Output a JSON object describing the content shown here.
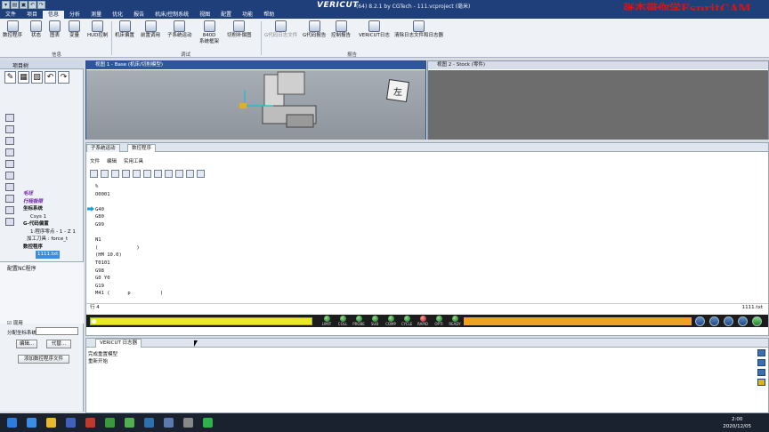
{
  "title": {
    "logo": "VERICUT",
    "text": "(64) 8.2.1 by CGTech - 111.vcproject (毫米)",
    "watermark": "张杰带你学EspritCAM"
  },
  "menu": [
    "文件",
    "项目",
    "信息",
    "分析",
    "测量",
    "优化",
    "报告",
    "机床/控制系统",
    "视图",
    "配置",
    "功能",
    "帮助"
  ],
  "menu_active_index": 2,
  "ribbon": {
    "buttons": [
      {
        "label": "数控程序"
      },
      {
        "label": "状态"
      },
      {
        "label": "图表"
      },
      {
        "label": "变量"
      },
      {
        "label": "HUD控制"
      },
      {
        "label": "机床偏置"
      },
      {
        "label": "前置调用"
      },
      {
        "label": "子系统运动"
      },
      {
        "label": "840D\n系统框架"
      },
      {
        "label": "切削补偿图"
      },
      {
        "label": "G代码日志文件",
        "disabled": true
      },
      {
        "label": "G代码报告"
      },
      {
        "label": "控制报告"
      },
      {
        "label": "VERICUT日志"
      },
      {
        "label": "清除日志文件和日志器"
      }
    ],
    "groups": [
      "信息",
      "调试",
      "报告"
    ]
  },
  "left_panel": {
    "header": "项目树",
    "tree": [
      {
        "text": "毛坯",
        "style": "hl"
      },
      {
        "text": "行程极限",
        "style": "hl"
      },
      {
        "text": "坐标系统",
        "style": "bold"
      },
      {
        "text": "Csys 1",
        "style": "normal"
      },
      {
        "text": "G-代码偏置",
        "style": "bold"
      },
      {
        "text": "1:程序零点 - 1 - Z 1",
        "style": "normal"
      },
      {
        "text": "加工刀具 : force_t",
        "style": "normal"
      },
      {
        "text": "数控程序",
        "style": "bold"
      },
      {
        "text": "1111.txt",
        "style": "sel"
      }
    ],
    "sub_header": "配置NC程序",
    "checkbox_label": "现用",
    "coord_label": "分配坐标系统",
    "edit_button": "编辑...",
    "replace_button": "代替...",
    "add_button": "添加数控程序文件"
  },
  "view1": {
    "title": "视图 1 - Base (机床/切削模型)",
    "cube_label": "左"
  },
  "view2": {
    "title": "视图 2 - Stock (零件)"
  },
  "editor": {
    "tabs": [
      "子系统运动",
      "数控程序"
    ],
    "active_tab": 1,
    "menu": [
      "文件",
      "编辑",
      "实用工具"
    ],
    "lines": [
      "%",
      "O0001",
      "",
      "G40",
      "G80",
      "G99",
      "",
      "N1",
      "(             )",
      "(HM 10.0)",
      "T0101",
      "G98",
      "G0 Y0",
      "G19",
      "M41 (      p          )"
    ],
    "status_left": "行 4",
    "status_right": "1111.txt",
    "progress": 0.0,
    "leds": [
      {
        "label": "LIMIT",
        "color": "green"
      },
      {
        "label": "COLL",
        "color": "green"
      },
      {
        "label": "PROBE",
        "color": "green"
      },
      {
        "label": "SUB",
        "color": "green"
      },
      {
        "label": "COMP",
        "color": "green"
      },
      {
        "label": "CYCLE",
        "color": "green"
      },
      {
        "label": "RAPID",
        "color": "red"
      },
      {
        "label": "OPTI",
        "color": "green"
      },
      {
        "label": "READY",
        "color": "green"
      }
    ]
  },
  "log": {
    "tab": "VERICUT 日志器",
    "lines": [
      "完成重置模型",
      "重新开始"
    ]
  },
  "taskbar": {
    "time": "2:00",
    "date": "2020/12/05"
  },
  "colors": {
    "title": "#1f3f7a",
    "view_active": "#2f5698",
    "progress": "#e8ea23",
    "orange": "#f0a020"
  }
}
